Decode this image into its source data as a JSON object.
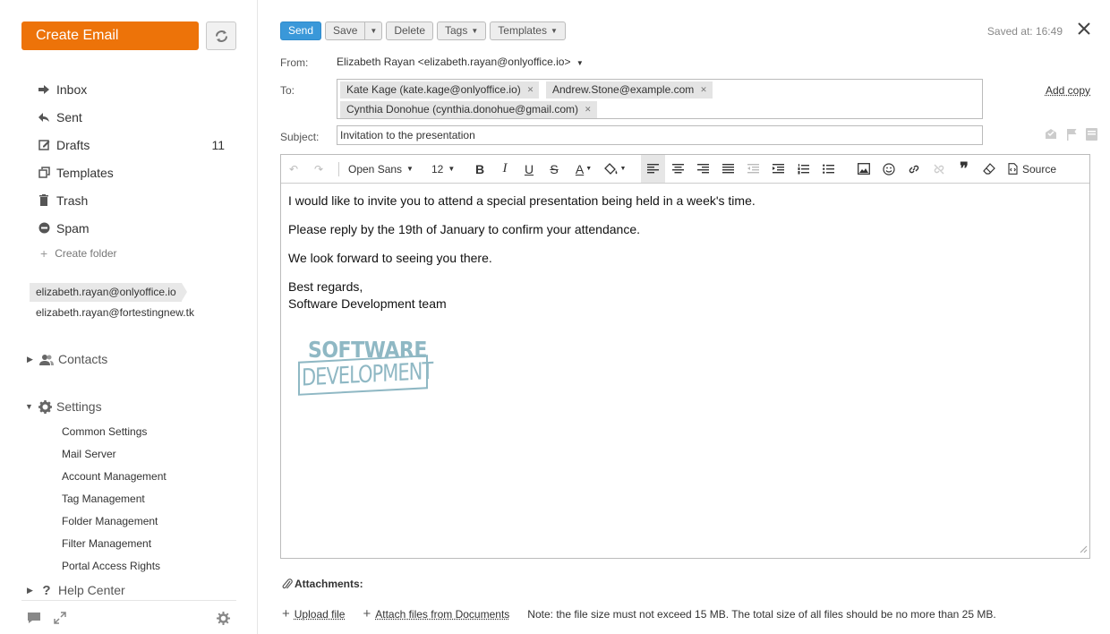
{
  "sidebar": {
    "create_label": "Create Email",
    "folders": [
      {
        "label": "Inbox",
        "icon": "arrow-right-icon",
        "count": ""
      },
      {
        "label": "Sent",
        "icon": "reply-icon",
        "count": ""
      },
      {
        "label": "Drafts",
        "icon": "edit-icon",
        "count": "11"
      },
      {
        "label": "Templates",
        "icon": "copy-icon",
        "count": ""
      },
      {
        "label": "Trash",
        "icon": "trash-icon",
        "count": ""
      },
      {
        "label": "Spam",
        "icon": "block-icon",
        "count": ""
      }
    ],
    "create_folder": "Create folder",
    "accounts": [
      "elizabeth.rayan@onlyoffice.io",
      "elizabeth.rayan@fortestingnew.tk"
    ],
    "contacts": "Contacts",
    "settings": "Settings",
    "settings_items": [
      "Common Settings",
      "Mail Server",
      "Account Management",
      "Tag Management",
      "Folder Management",
      "Filter Management",
      "Portal Access Rights"
    ],
    "help_center": "Help Center"
  },
  "toolbar": {
    "send": "Send",
    "save": "Save",
    "delete": "Delete",
    "tags": "Tags",
    "templates": "Templates",
    "saved": "Saved at: 16:49"
  },
  "compose": {
    "from_label": "From:",
    "from_value": "Elizabeth Rayan <elizabeth.rayan@onlyoffice.io>",
    "to_label": "To:",
    "recipients": [
      "Kate Kage (kate.kage@onlyoffice.io)",
      "Andrew.Stone@example.com",
      "Cynthia Donohue (cynthia.donohue@gmail.com)"
    ],
    "add_copy": "Add copy",
    "subject_label": "Subject:",
    "subject_value": "Invitation to the presentation"
  },
  "editor": {
    "font": "Open Sans",
    "size": "12",
    "source": "Source",
    "body": [
      "I would like to invite you to attend a special presentation being held in a week's time.",
      "Please reply by the 19th of January to confirm your attendance.",
      "We look forward to seeing you there."
    ],
    "signature_1": "Best regards,",
    "signature_2": "Software Development team",
    "logo_line1": "SOFTWARE",
    "logo_line2": "DEVELOPMENT"
  },
  "attachments": {
    "label": "Attachments:",
    "upload": "Upload file",
    "attach_docs": "Attach files from Documents",
    "note": "Note: the file size must not exceed 15 MB. The total size of all files should be no more than 25 MB."
  },
  "colors": {
    "accent": "#ed7309",
    "send": "#3a98d9"
  }
}
